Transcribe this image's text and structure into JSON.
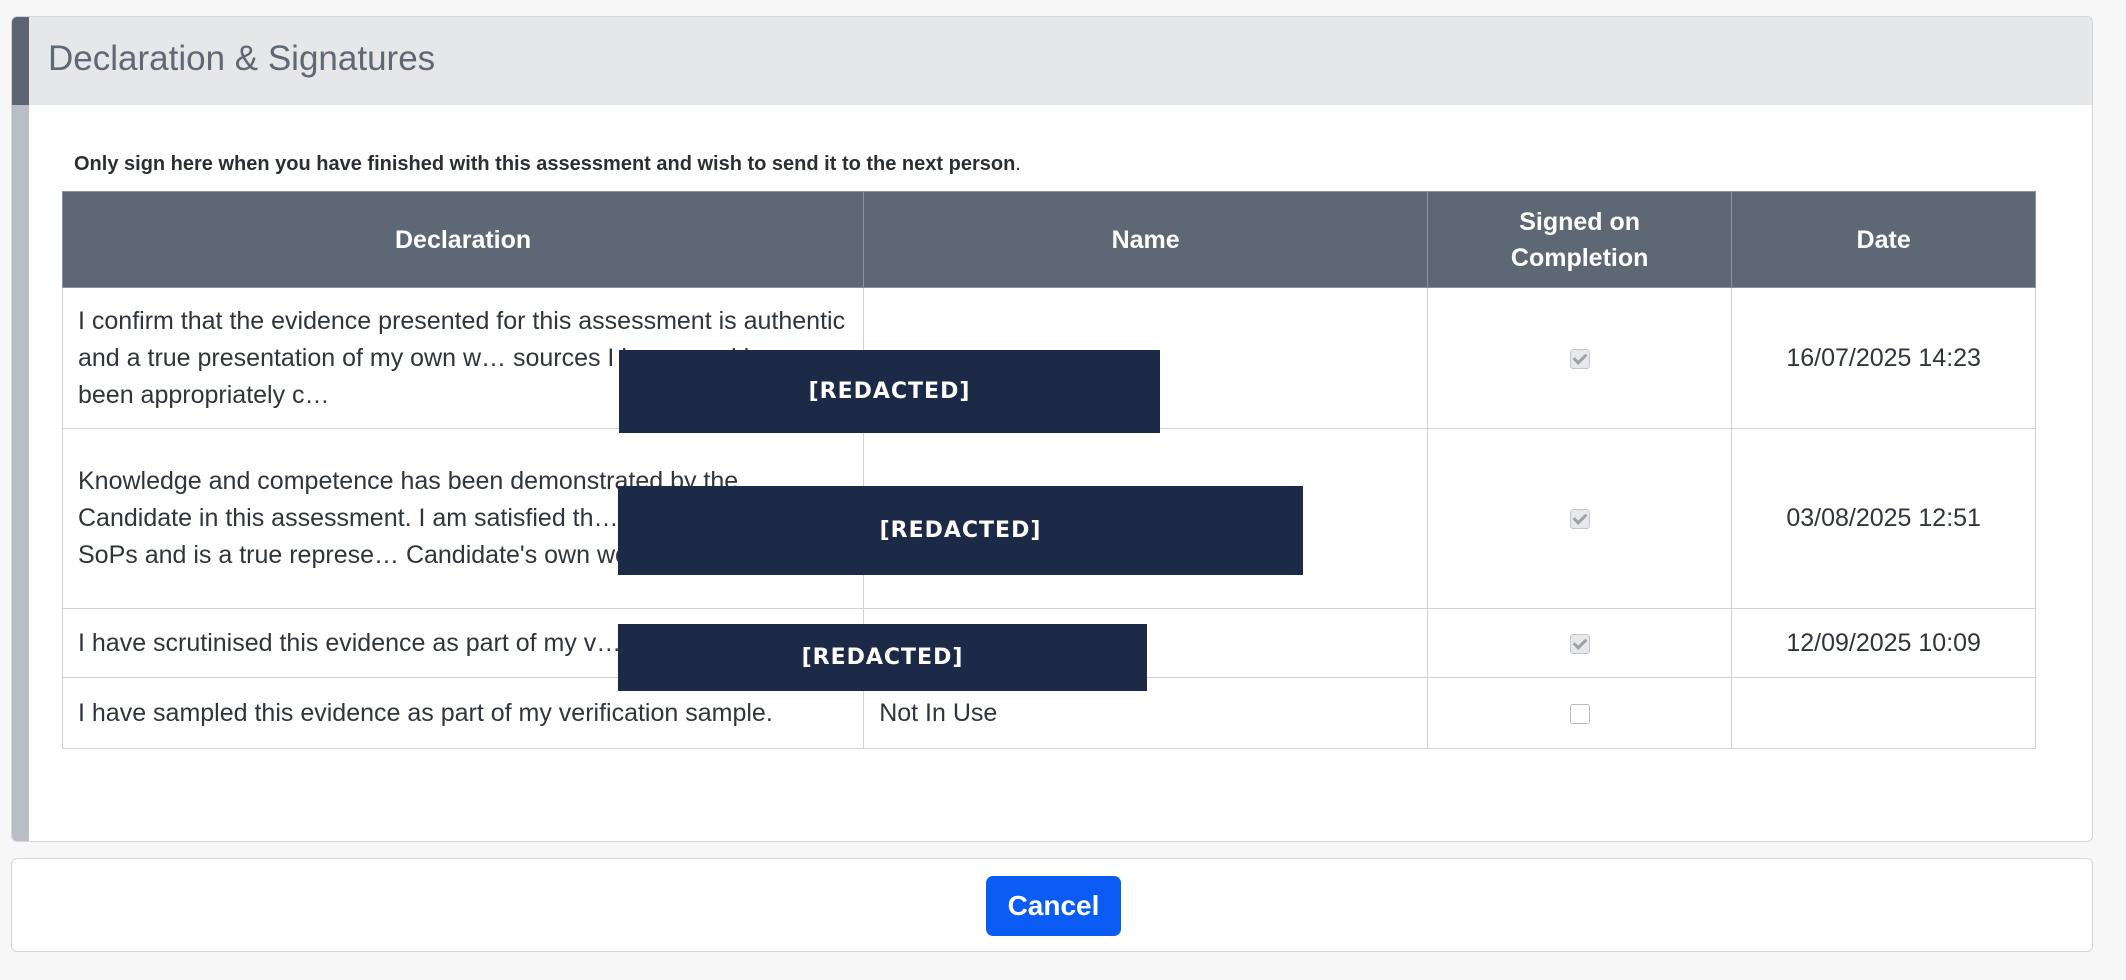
{
  "panel": {
    "title": "Declaration & Signatures",
    "instruction": "Only sign here when you have finished with this assessment and wish to send it to the next person",
    "instruction_end": "."
  },
  "table": {
    "headers": {
      "declaration": "Declaration",
      "name": "Name",
      "signed": "Signed on Completion",
      "date": "Date"
    },
    "rows": [
      {
        "declaration": "I confirm that the evidence presented for this assessment is authentic and a true presentation of my own w… sources I have used have been appropriately c…",
        "name": "",
        "signed": true,
        "date": "16/07/2025 14:23"
      },
      {
        "declaration": "Knowledge and competence has been demonstrated by the Candidate in this assessment. I am satisfied th… meets the mapped SoPs and is a true represe… Candidate's own work.",
        "name": "",
        "signed": true,
        "date": "03/08/2025 12:51"
      },
      {
        "declaration": "I have scrutinised this evidence as part of my v…",
        "name": "",
        "signed": true,
        "date": "12/09/2025 10:09"
      },
      {
        "declaration": "I have sampled this evidence as part of my verification sample.",
        "name": "Not In Use",
        "signed": false,
        "date": ""
      }
    ]
  },
  "redactions": [
    "[REDACTED]",
    "[REDACTED]",
    "[REDACTED]"
  ],
  "footer": {
    "cancel_label": "Cancel"
  },
  "colors": {
    "header_bg": "#5e6875",
    "accent_dark": "#5c6571",
    "redaction_bg": "#1c2a48",
    "primary_button": "#0b5cf5"
  }
}
